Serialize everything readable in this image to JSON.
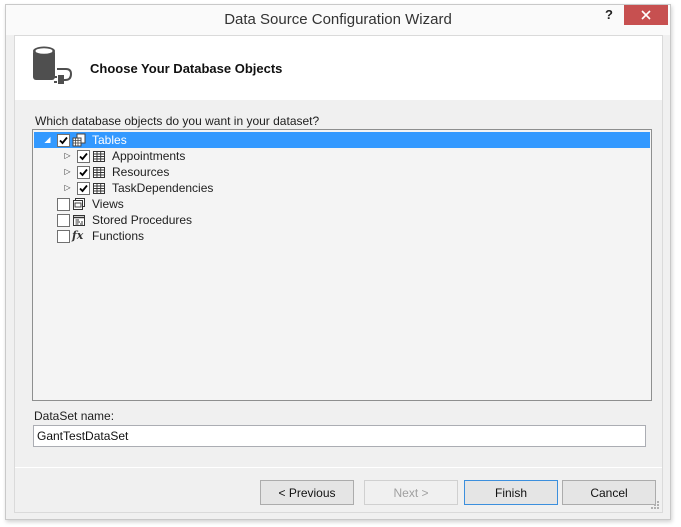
{
  "window": {
    "title": "Data Source Configuration Wizard",
    "help_label": "?",
    "close_label": "x"
  },
  "header": {
    "title": "Choose Your Database Objects",
    "icon": "database-connection-icon"
  },
  "tree": {
    "prompt": "Which database objects do you want in your dataset?",
    "items": [
      {
        "label": "Tables",
        "checked": true,
        "expanded": true,
        "selected": true,
        "icon": "tables-icon",
        "level": 0
      },
      {
        "label": "Appointments",
        "checked": true,
        "expanded": false,
        "icon": "table-icon",
        "level": 1
      },
      {
        "label": "Resources",
        "checked": true,
        "expanded": false,
        "icon": "table-icon",
        "level": 1
      },
      {
        "label": "TaskDependencies",
        "checked": true,
        "expanded": false,
        "icon": "table-icon",
        "level": 1
      },
      {
        "label": "Views",
        "checked": false,
        "icon": "views-icon",
        "level": 0
      },
      {
        "label": "Stored Procedures",
        "checked": false,
        "icon": "stored-procedure-icon",
        "level": 0
      },
      {
        "label": "Functions",
        "checked": false,
        "icon": "function-icon",
        "level": 0
      }
    ],
    "selection_color": "#3399ff"
  },
  "dataset": {
    "label": "DataSet name:",
    "value": "GantTestDataSet"
  },
  "buttons": {
    "previous": "< Previous",
    "next": "Next >",
    "finish": "Finish",
    "cancel": "Cancel"
  },
  "colors": {
    "close_button": "#c75050",
    "default_button_border": "#3c8fdd"
  }
}
